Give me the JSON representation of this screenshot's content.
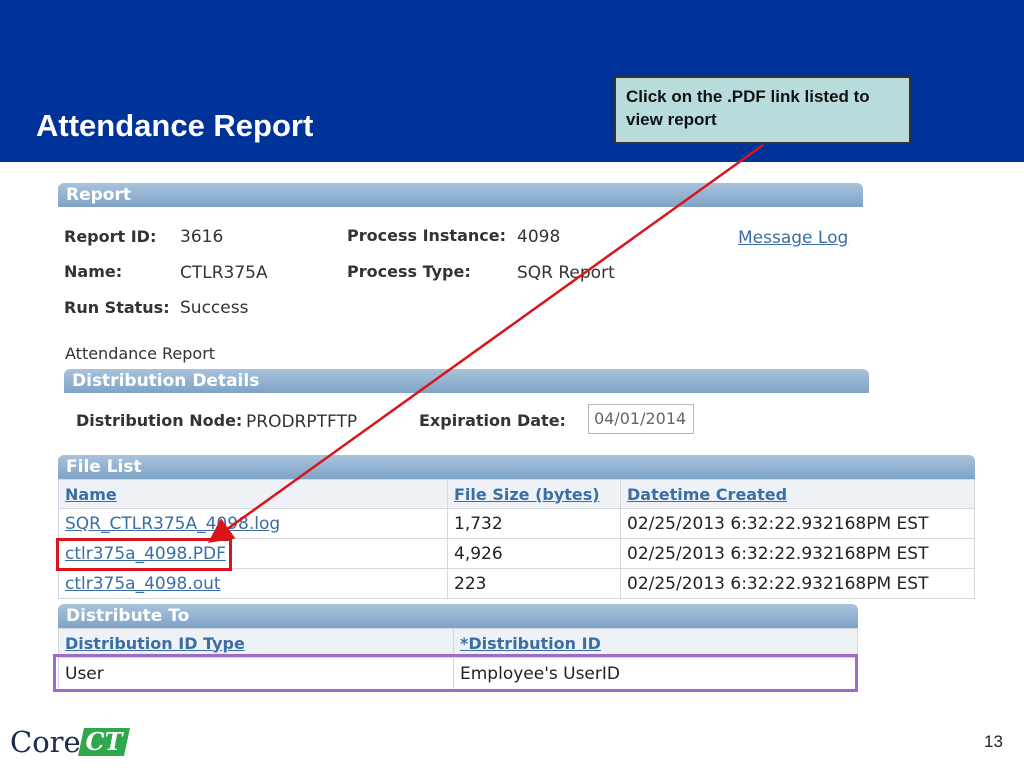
{
  "slide": {
    "title": "Attendance Report",
    "callout": "Click on the .PDF link listed to view report",
    "page_number": "13",
    "logo_text": "Core-CT",
    "logo_core": "Core-",
    "logo_ct": "CT"
  },
  "report": {
    "section_title": "Report",
    "report_id_label": "Report ID:",
    "report_id": "3616",
    "name_label": "Name:",
    "name": "CTLR375A",
    "run_status_label": "Run Status:",
    "run_status": "Success",
    "process_instance_label": "Process Instance:",
    "process_instance": "4098",
    "process_type_label": "Process Type:",
    "process_type": "SQR Report",
    "message_log_link": "Message Log",
    "description": "Attendance Report"
  },
  "distribution_details": {
    "section_title": "Distribution Details",
    "node_label": "Distribution Node:",
    "node": "PRODRPTFTP",
    "expiration_label": "Expiration Date:",
    "expiration_date": "04/01/2014"
  },
  "file_list": {
    "section_title": "File List",
    "columns": [
      "Name",
      "File Size (bytes)",
      "Datetime Created"
    ],
    "rows": [
      {
        "name": "SQR_CTLR375A_4098.log",
        "size": "1,732",
        "created": "02/25/2013  6:32:22.932168PM EST"
      },
      {
        "name": "ctlr375a_4098.PDF",
        "size": "4,926",
        "created": "02/25/2013  6:32:22.932168PM EST"
      },
      {
        "name": "ctlr375a_4098.out",
        "size": "223",
        "created": "02/25/2013  6:32:22.932168PM EST"
      }
    ]
  },
  "distribute_to": {
    "section_title": "Distribute To",
    "columns": [
      "Distribution ID Type",
      "*Distribution ID"
    ],
    "rows": [
      {
        "type": "User",
        "id": "Employee's UserID"
      }
    ]
  },
  "colors": {
    "banner": "#003399",
    "callout_bg": "#b8dcdc",
    "highlight_red": "#d9141a",
    "highlight_purple": "#a06bc7",
    "link": "#3a6ea5"
  }
}
